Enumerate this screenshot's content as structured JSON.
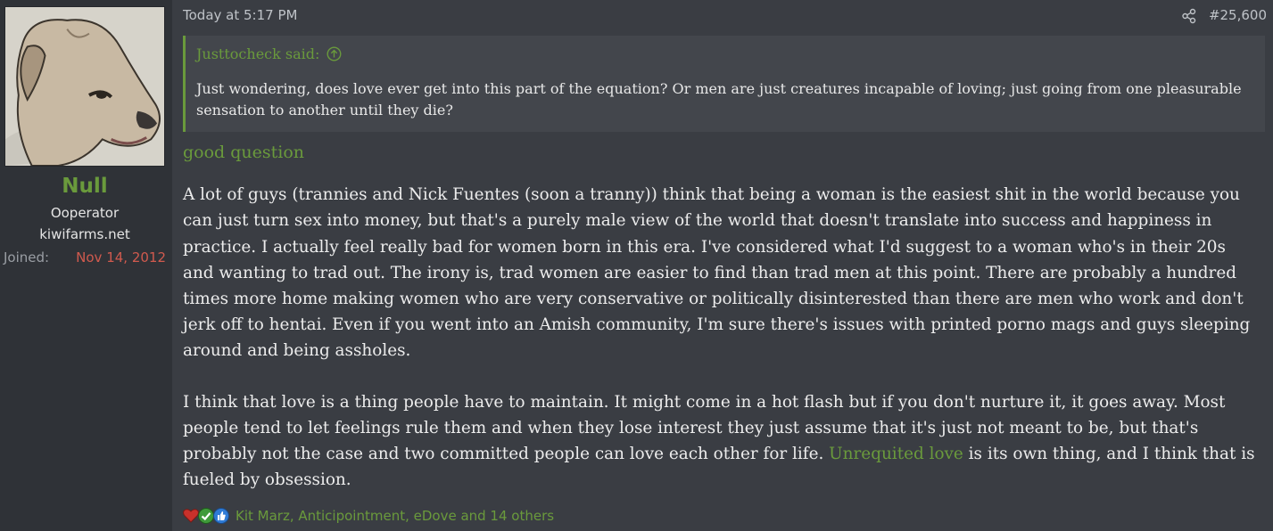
{
  "user": {
    "name": "Null",
    "title": "Ooperator",
    "site": "kiwifarms.net",
    "joined_label": "Joined:",
    "joined_value": "Nov 14, 2012"
  },
  "post": {
    "time": "Today at 5:17 PM",
    "number": "#25,600",
    "quote": {
      "author_said": "Justtocheck said:",
      "text": "Just wondering, does love ever get into this part of the equation? Or men are just creatures incapable of loving; just going from one pleasurable sensation to another until they die?"
    },
    "lead": "good question",
    "para1": "A lot of guys (trannies and Nick Fuentes (soon a tranny)) think that being a woman is the easiest shit in the world because you can just turn sex into money, but that's a purely male view of the world that doesn't translate into success and happiness in practice. I actually feel really bad for women born in this era. I've considered what I'd suggest to a woman who's in their 20s and wanting to trad out. The irony is, trad women are easier to find than trad men at this point. There are probably a hundred times more home making women who are very conservative or politically disinterested than there are men who work and don't jerk off to hentai. Even if you went into an Amish community, I'm sure there's issues with printed porno mags and guys sleeping around and being assholes.",
    "para2_before": "I think that love is a thing people have to maintain. It might come in a hot flash but if you don't nurture it, it goes away. Most people tend to let feelings rule them and when they lose interest they just assume that it's just not meant to be, but that's probably not the case and two committed people can love each other for life. ",
    "para2_link": "Unrequited love",
    "para2_after": " is its own thing, and I think that is fueled by obsession.",
    "reactions_text": "Kit Marz, Anticipointment, eDove and 14 others"
  },
  "icons": {
    "share": "share-icon",
    "quote_up": "arrow-up-circle-icon",
    "reactions": [
      "heart-icon",
      "check-icon",
      "thumbs-up-icon"
    ]
  },
  "colors": {
    "accent": "#6a9a3c",
    "background": "#3a3d43",
    "sidebar": "#2f3237",
    "quote_bg": "#43464c",
    "joined_date": "#d05a4e"
  }
}
